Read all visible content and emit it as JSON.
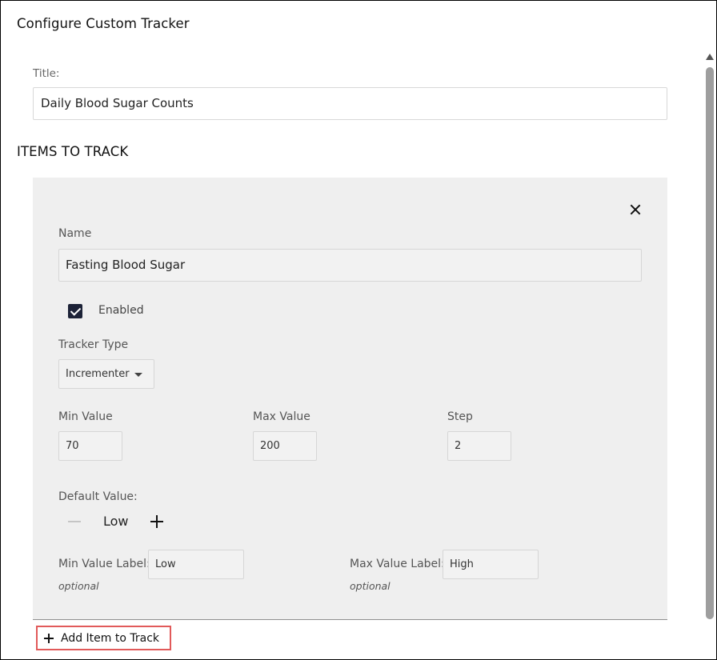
{
  "dialog": {
    "title": "Configure Custom Tracker"
  },
  "tracker": {
    "title_label": "Title:",
    "title_value": "Daily Blood Sugar Counts"
  },
  "items_section": {
    "heading": "ITEMS TO TRACK"
  },
  "item": {
    "remove_icon": "close-icon",
    "name_label": "Name",
    "name_value": "Fasting Blood Sugar",
    "enabled_label": "Enabled",
    "enabled": true,
    "tracker_type_label": "Tracker Type",
    "tracker_type_value": "Incrementer",
    "min_value_label": "Min Value",
    "min_value": "70",
    "max_value_label": "Max Value",
    "max_value": "200",
    "step_label": "Step",
    "step_value": "2",
    "default_value_label": "Default Value:",
    "default_value": "Low",
    "min_value_label_field": "Min Value Label:",
    "min_value_label_value": "Low",
    "max_value_label_field": "Max Value Label:",
    "max_value_label_value": "High",
    "optional_text": "optional"
  },
  "actions": {
    "add_item_label": "Add Item to Track"
  },
  "colors": {
    "panel_background": "#efefef",
    "checkbox": "#1c2237",
    "highlight_border": "#e15a5a"
  }
}
